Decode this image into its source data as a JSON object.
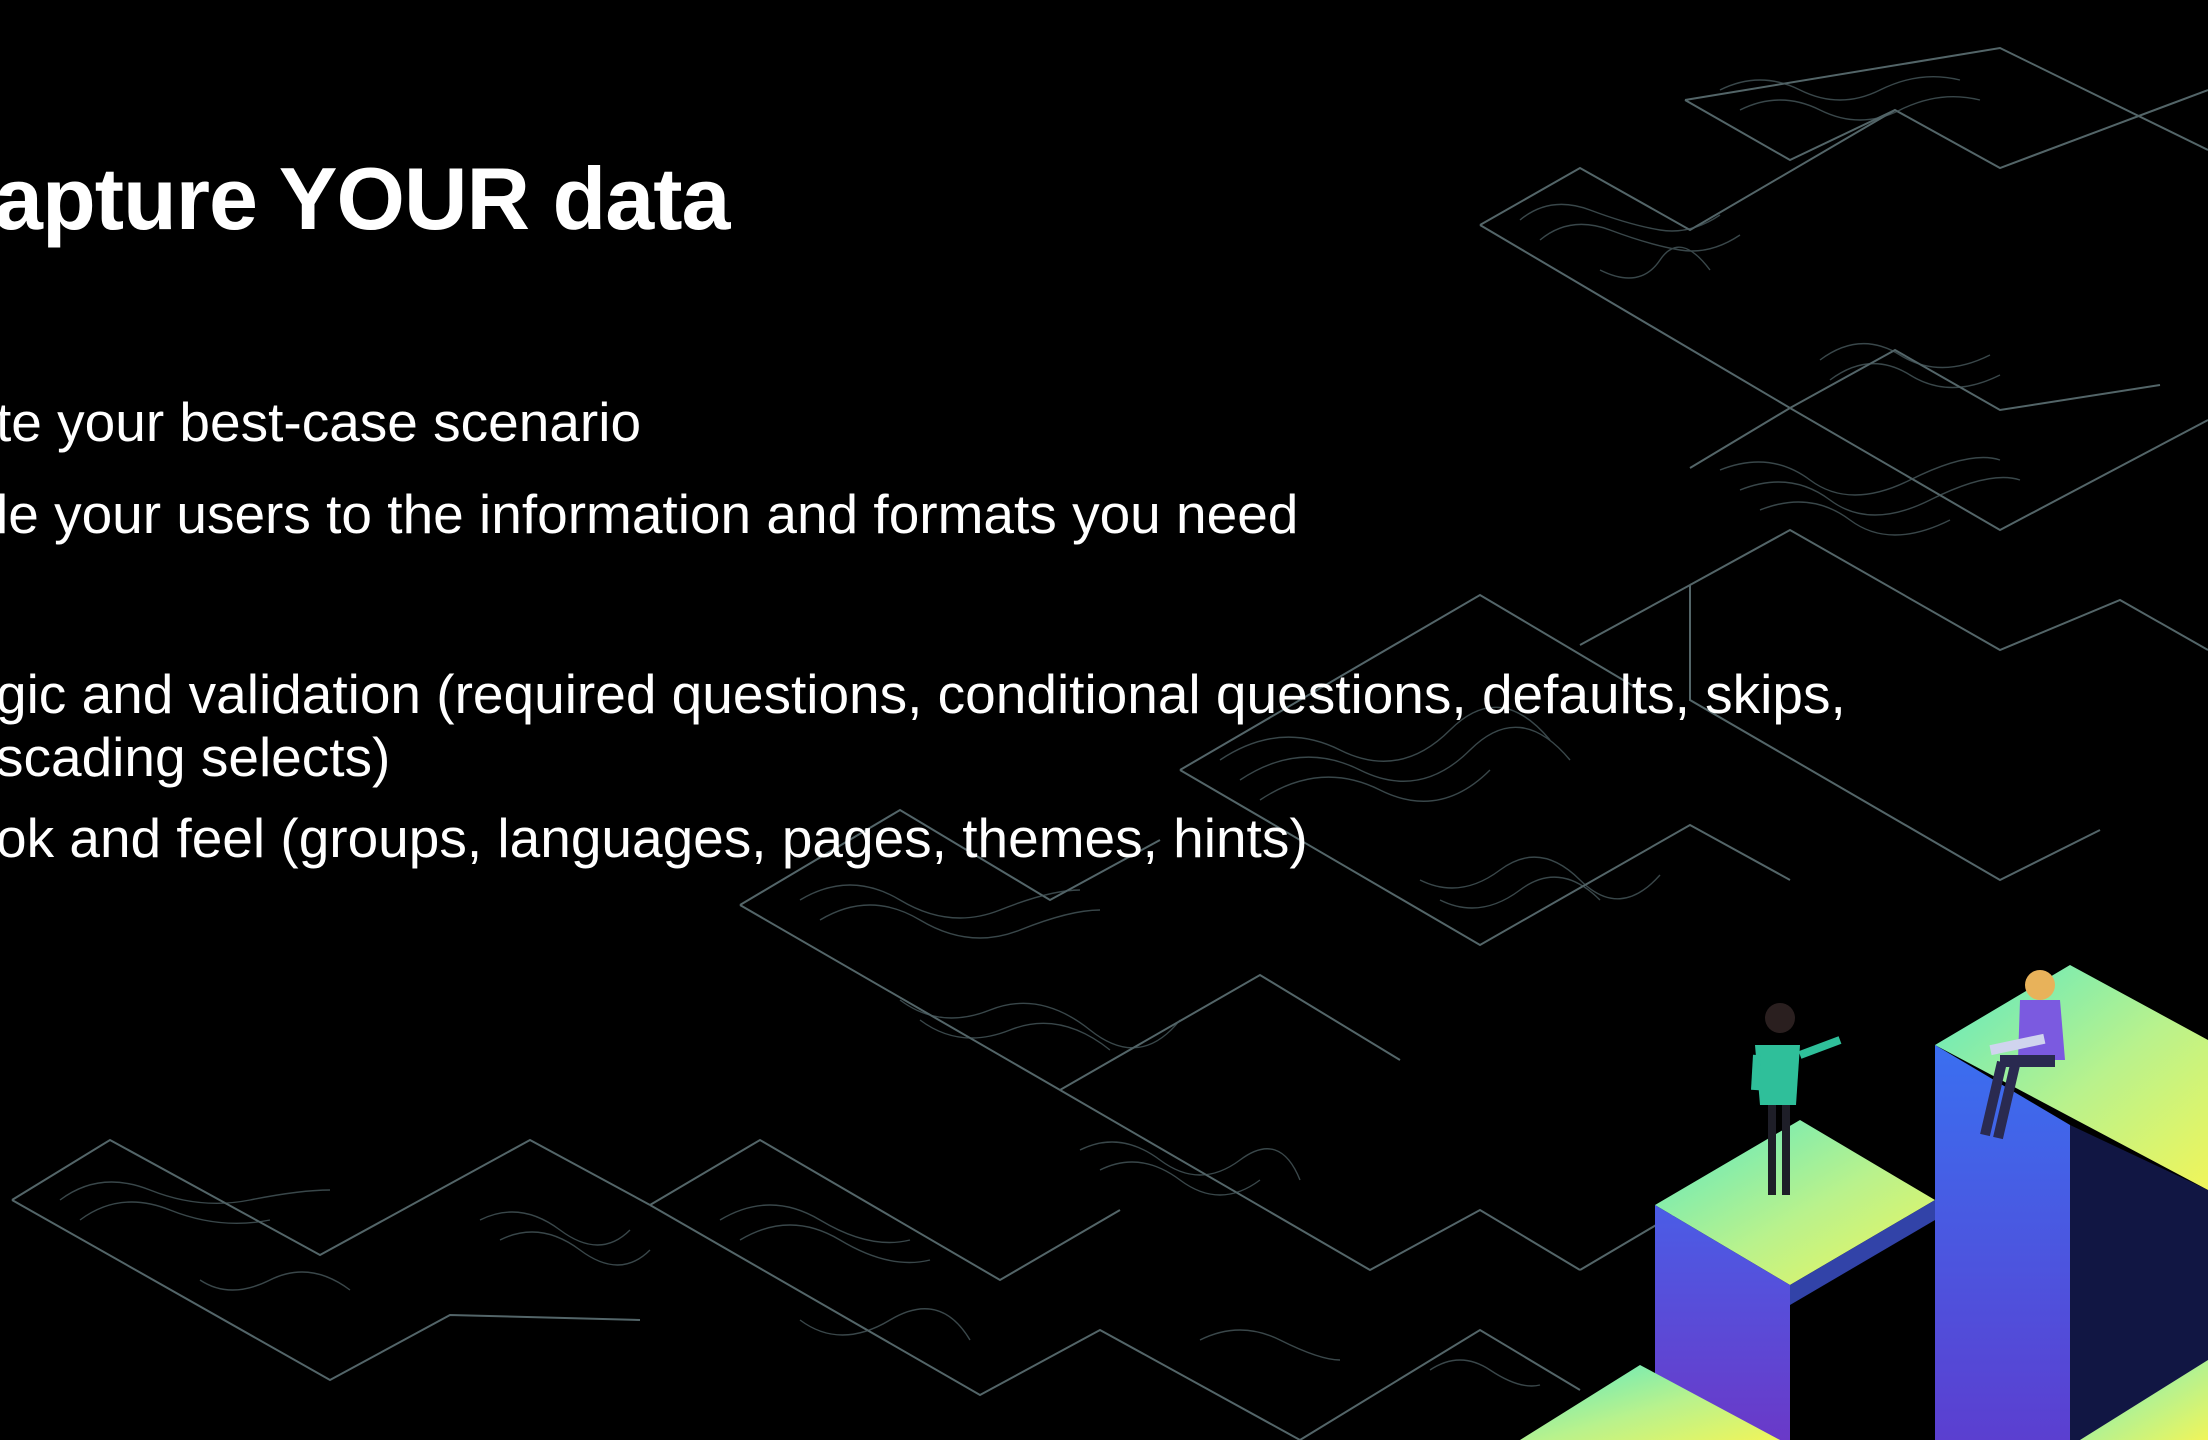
{
  "slide": {
    "title": "apture YOUR data",
    "lines": [
      "te your best-case scenario",
      "le your users to the information and formats you need",
      "gic and validation (required questions, conditional questions, defaults, skips,",
      "scading selects)",
      "ok and feel (groups, languages, pages, themes, hints)"
    ]
  },
  "colors": {
    "background": "#000000",
    "text": "#ffffff",
    "map_lines": "#6f8488",
    "platform_green": "#8ff0a4",
    "platform_blue": "#3b4fd8",
    "platform_yellow": "#e8f060"
  }
}
